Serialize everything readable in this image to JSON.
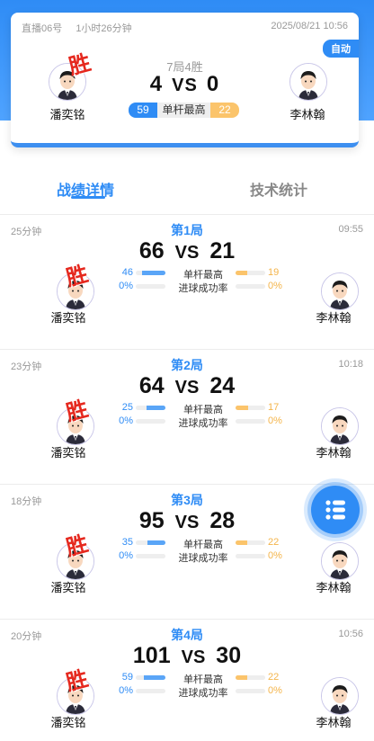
{
  "match": {
    "meta_label": "直播06号",
    "duration": "1小时26分钟",
    "date": "2025/08/21 10:56",
    "auto_label": "自动",
    "format": "7局4胜",
    "score_left": "4",
    "vs": "VS",
    "score_right": "0",
    "high_break_left": "59",
    "high_break_label": "单杆最高",
    "high_break_right": "22",
    "win_label": "胜",
    "player_left": "潘奕铭",
    "player_right": "李林翰"
  },
  "tabs": {
    "active": "战绩详情",
    "inactive": "技术统计"
  },
  "colors": {
    "accent": "#2f8cf5",
    "orange": "#fbc46b",
    "win": "#e5281e"
  },
  "rounds": [
    {
      "duration": "25分钟",
      "title": "第1局",
      "score_left": "66",
      "vs": "VS",
      "score_right": "21",
      "time": "09:55",
      "hb_left": "46",
      "hb_label": "单杆最高",
      "hb_right": "19",
      "hb_left_frac": 0.79,
      "hb_right_frac": 0.4,
      "pot_left": "0%",
      "pot_label": "进球成功率",
      "pot_right": "0%",
      "winner": "left",
      "win_label": "胜",
      "player_left": "潘奕铭",
      "player_right": "李林翰"
    },
    {
      "duration": "23分钟",
      "title": "第2局",
      "score_left": "64",
      "vs": "VS",
      "score_right": "24",
      "time": "10:18",
      "hb_left": "25",
      "hb_label": "单杆最高",
      "hb_right": "17",
      "hb_left_frac": 0.63,
      "hb_right_frac": 0.42,
      "pot_left": "0%",
      "pot_label": "进球成功率",
      "pot_right": "0%",
      "winner": "left",
      "win_label": "胜",
      "player_left": "潘奕铭",
      "player_right": "李林翰"
    },
    {
      "duration": "18分钟",
      "title": "第3局",
      "score_left": "95",
      "vs": "VS",
      "score_right": "28",
      "time": "",
      "hb_left": "35",
      "hb_label": "单杆最高",
      "hb_right": "22",
      "hb_left_frac": 0.62,
      "hb_right_frac": 0.38,
      "pot_left": "0%",
      "pot_label": "进球成功率",
      "pot_right": "0%",
      "winner": "left",
      "win_label": "胜",
      "player_left": "潘奕铭",
      "player_right": "李林翰"
    },
    {
      "duration": "20分钟",
      "title": "第4局",
      "score_left": "101",
      "vs": "VS",
      "score_right": "30",
      "time": "10:56",
      "hb_left": "59",
      "hb_label": "单杆最高",
      "hb_right": "22",
      "hb_left_frac": 0.73,
      "hb_right_frac": 0.4,
      "pot_left": "0%",
      "pot_label": "进球成功率",
      "pot_right": "0%",
      "winner": "left",
      "win_label": "胜",
      "player_left": "潘奕铭",
      "player_right": "李林翰"
    }
  ],
  "fab": {
    "icon": "list-icon"
  }
}
